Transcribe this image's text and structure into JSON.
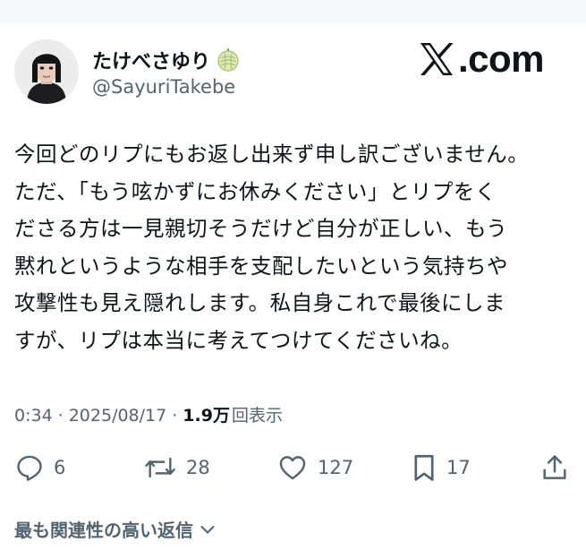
{
  "author": {
    "display_name": "たけべさゆり",
    "handle": "@SayuriTakebe",
    "badge_icon": "melon-emoji-icon"
  },
  "site": {
    "logo_icon": "x-logo-icon",
    "domain_text": ".com"
  },
  "tweet": {
    "lines": [
      "今回どのリプにもお返し出来ず申し訳ございません。",
      "ただ、「もう呟かずにお休みください」とリプをく",
      "ださる方は一見親切そうだけど自分が正しい、もう",
      "黙れというような相手を支配したいという気持ちや",
      "攻撃性も見え隠れします。私自身これで最後にしま",
      "すが、リプは本当に考えてつけてくださいね。"
    ]
  },
  "meta": {
    "time": "0:34",
    "separator": "·",
    "date": "2025/08/17",
    "views_count": "1.9万",
    "views_label": "回表示"
  },
  "actions": {
    "reply": {
      "icon": "reply-icon",
      "count": "6"
    },
    "retweet": {
      "icon": "retweet-icon",
      "count": "28"
    },
    "like": {
      "icon": "heart-icon",
      "count": "127"
    },
    "bookmark": {
      "icon": "bookmark-icon",
      "count": "17"
    },
    "share": {
      "icon": "share-icon"
    }
  },
  "replies": {
    "sort_label": "最も関連性の高い返信"
  },
  "colors": {
    "text": "#0f1419",
    "secondary": "#536471",
    "background": "#ffffff"
  }
}
